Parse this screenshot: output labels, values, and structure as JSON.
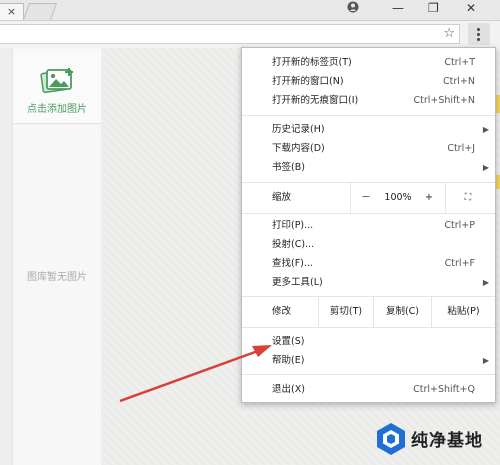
{
  "titlebar": {
    "close_glyph": "×",
    "min": "—",
    "max": "❐",
    "close": "✕",
    "user_icon": "user-icon"
  },
  "toolbar": {
    "star_icon": "star-icon",
    "menu_icon": "more-vert-icon"
  },
  "left_panel": {
    "add_image_label": "点击添加图片",
    "empty_text": "图库暂无图片"
  },
  "menu": {
    "new_tab": {
      "label": "打开新的标签页(T)",
      "shortcut": "Ctrl+T"
    },
    "new_window": {
      "label": "打开新的窗口(N)",
      "shortcut": "Ctrl+N"
    },
    "incognito": {
      "label": "打开新的无痕窗口(I)",
      "shortcut": "Ctrl+Shift+N"
    },
    "history": {
      "label": "历史记录(H)"
    },
    "downloads": {
      "label": "下载内容(D)",
      "shortcut": "Ctrl+J"
    },
    "bookmarks": {
      "label": "书签(B)"
    },
    "zoom": {
      "label": "缩放",
      "minus": "－",
      "value": "100%",
      "plus": "+",
      "fullscreen": "⛶"
    },
    "print": {
      "label": "打印(P)...",
      "shortcut": "Ctrl+P"
    },
    "cast": {
      "label": "投射(C)..."
    },
    "find": {
      "label": "查找(F)...",
      "shortcut": "Ctrl+F"
    },
    "more_tools": {
      "label": "更多工具(L)"
    },
    "edit": {
      "label": "修改",
      "cut": "剪切(T)",
      "copy": "复制(C)",
      "paste": "粘贴(P)"
    },
    "settings": {
      "label": "设置(S)"
    },
    "help": {
      "label": "帮助(E)"
    },
    "exit": {
      "label": "退出(X)",
      "shortcut": "Ctrl+Shift+Q"
    },
    "arrow": "▶"
  },
  "annotation": {
    "arrow_color": "#d9403a"
  },
  "watermark": {
    "text": "纯净基地",
    "icon": "logo-icon"
  },
  "colors": {
    "accent_green": "#4a9b5f",
    "logo_blue": "#1f6fd6",
    "edge_yellow": "#f2d35c"
  }
}
